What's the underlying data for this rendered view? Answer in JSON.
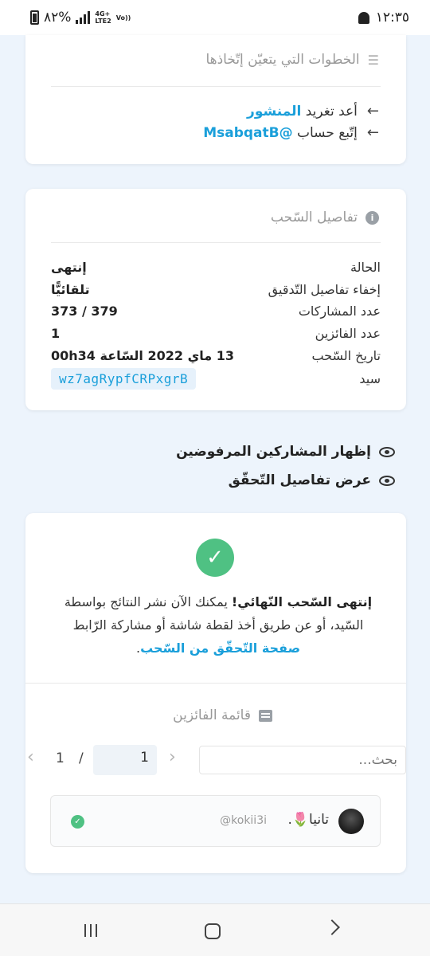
{
  "status_bar": {
    "time": "١٢:٣٥",
    "battery": "٨٢%",
    "network": [
      "4G+",
      "LTE2"
    ],
    "volte": "Vo))"
  },
  "steps": {
    "title": "الخطوات التي يتعيّن إتّخاذها",
    "items": [
      {
        "prefix": "أعد تغريد ",
        "highlight": "المنشور"
      },
      {
        "prefix": "إتّبع حساب ",
        "highlight": "@MsabqatB"
      }
    ]
  },
  "details": {
    "title": "تفاصيل السّحب",
    "rows": [
      {
        "label": "الحالة",
        "value": "إنتهى"
      },
      {
        "label": "إخفاء تفاصيل التّدقيق",
        "value": "تلقائيًّا"
      },
      {
        "label": "عدد المشاركات",
        "value": "373 / 379"
      },
      {
        "label": "عدد الفائزين",
        "value": "1"
      },
      {
        "label": "تاريخ السّحب",
        "value": "13 ماي 2022 السّاعة 00h34"
      },
      {
        "label": "سيد",
        "value": "wz7agRypfCRPxgrB"
      }
    ]
  },
  "toggles": {
    "rejected": "إظهار المشاركين المرفوضين",
    "verification": "عرض تفاصيل التّحقّق"
  },
  "result": {
    "bold": "إنتهى السّحب النّهائي!",
    "text": " يمكنك الآن نشر النتائج بواسطة السّيد، أو عن طريق أخذ لقطة شاشة أو مشاركة الرّابط ",
    "link": "صفحة التّحقّق من السّحب",
    "end": "."
  },
  "winners": {
    "title": "قائمة الفائزين",
    "search_placeholder": "بحث...",
    "page_current": "1",
    "page_separator": "/",
    "page_total": "1",
    "list": [
      {
        "name": "تانيا🌷.",
        "handle": "@kokii3i"
      }
    ]
  },
  "colors": {
    "accent": "#1a9fda",
    "success": "#4fc183",
    "background": "#edf4fc"
  }
}
